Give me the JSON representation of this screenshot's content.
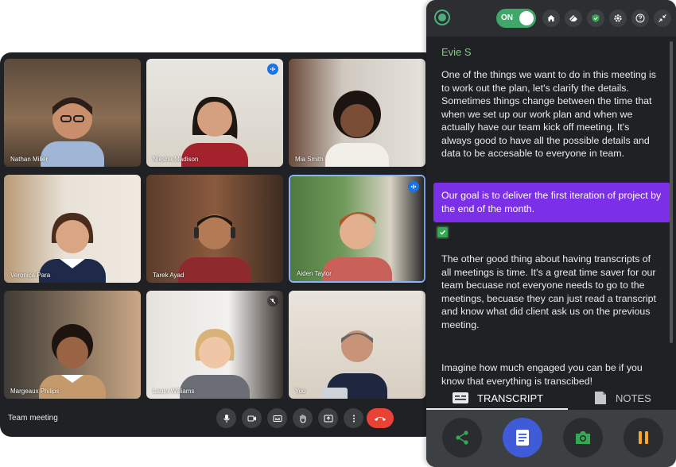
{
  "meeting": {
    "title": "Team meeting",
    "participants": [
      {
        "name": "Nathan Miller"
      },
      {
        "name": "Niesha Madison"
      },
      {
        "name": "Mia Smith"
      },
      {
        "name": "Veronica Para"
      },
      {
        "name": "Tarek Ayad"
      },
      {
        "name": "Aiden Taylor"
      },
      {
        "name": "Margeaux Philips"
      },
      {
        "name": "Laura Williams"
      },
      {
        "name": "You"
      }
    ],
    "controls": [
      "mic-icon",
      "camera-icon",
      "captions-icon",
      "raise-hand-icon",
      "present-icon",
      "more-icon",
      "end-call-icon"
    ]
  },
  "panel": {
    "toggle_label": "ON",
    "toolbar_icons": [
      "home-icon",
      "eraser-icon",
      "shield-icon",
      "gear-icon",
      "help-icon",
      "collapse-icon"
    ],
    "speaker": "Evie S",
    "paragraphs": [
      "One of the things we want to do in this meeting is to work out the plan, let's clarify the details. Sometimes things change between the time that when we set up our work plan and when we actually have our team kick off meeting. It's always good to have all the possible details and data to be accesable to everyone in team.",
      "The other good thing about having transcripts of all meetings is time. It's a great time saver for our team becuase not everyone needs to go to the meetings, becuase they can just read a transcript and know what did client ask us on the previous meeting.",
      "Imagine how much engaged you can be if you know that everything is transcibed!"
    ],
    "highlight": "Our goal is to deliver the first iteration of project by the end of the month.",
    "tabs": [
      {
        "label": "TRANSCRIPT",
        "active": true
      },
      {
        "label": "NOTES",
        "active": false
      }
    ],
    "actions": [
      "share-icon",
      "document-icon",
      "camera-icon",
      "pause-icon"
    ]
  },
  "colors": {
    "highlight": "#7b2fe6",
    "toggle": "#3fa868",
    "speaker": "#7fcf7f",
    "end_call": "#ea4335",
    "action_pause": "#f9a825",
    "action_share": "#34a853"
  }
}
